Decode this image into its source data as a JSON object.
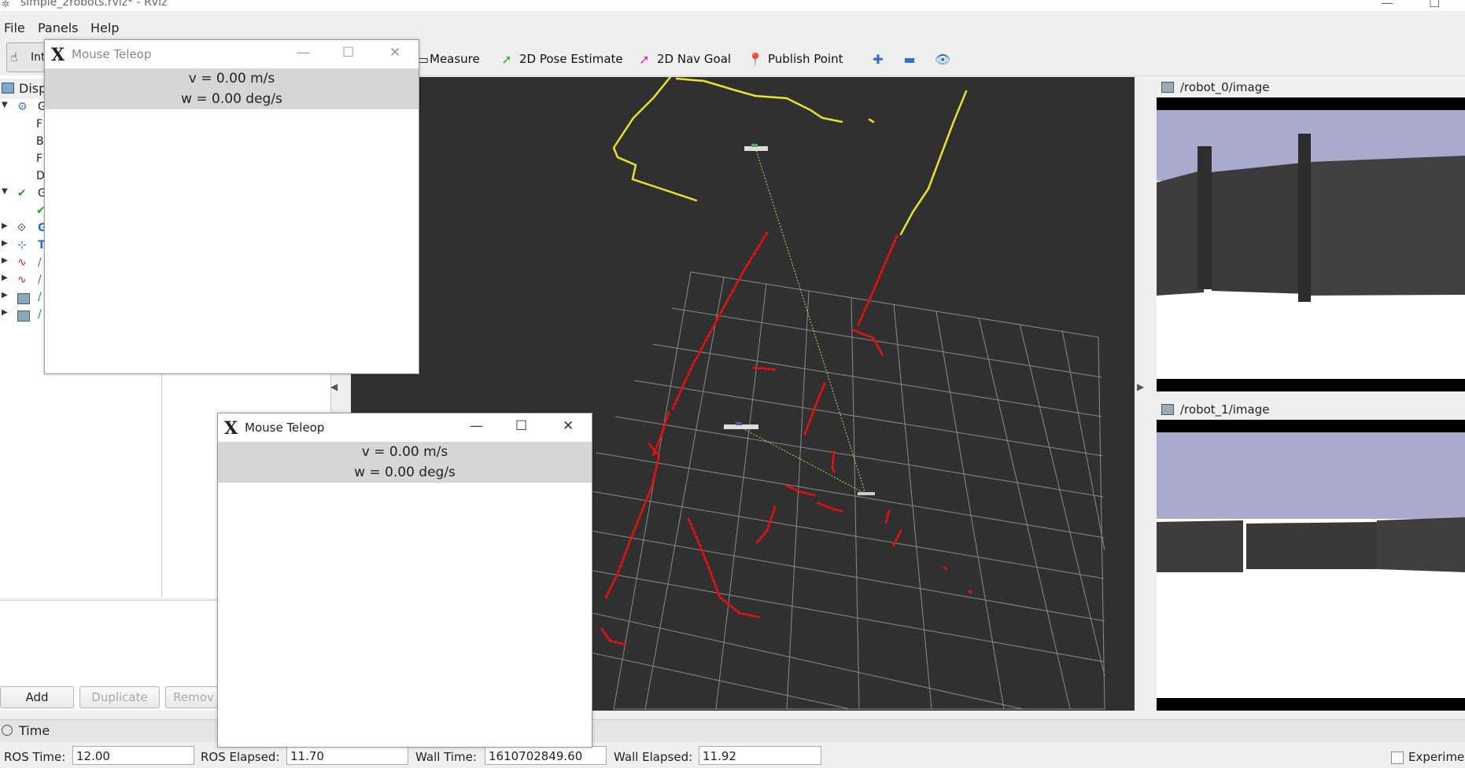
{
  "window": {
    "title": "simple_2robots.rviz* - RViz"
  },
  "menu": [
    "File",
    "Panels",
    "Help"
  ],
  "toolbar": {
    "interact": "Int",
    "measure": "Measure",
    "pose_estimate": "2D Pose Estimate",
    "nav_goal": "2D Nav Goal",
    "publish_point": "Publish Point"
  },
  "displays": {
    "header": "Disp",
    "rows": [
      "G",
      "F",
      "B",
      "F",
      "D",
      "G",
      "",
      "G",
      "T",
      "/",
      "/",
      "/",
      "/"
    ],
    "buttons": {
      "add": "Add",
      "duplicate": "Duplicate",
      "remove": "Remov"
    }
  },
  "image_panels": [
    {
      "title": "/robot_0/image"
    },
    {
      "title": "/robot_1/image"
    }
  ],
  "time": {
    "panel_title": "Time",
    "ros_time_label": "ROS Time:",
    "ros_time": "12.00",
    "ros_elapsed_label": "ROS Elapsed:",
    "ros_elapsed": "11.70",
    "wall_time_label": "Wall Time:",
    "wall_time": "1610702849.60",
    "wall_elapsed_label": "Wall Elapsed:",
    "wall_elapsed": "11.92",
    "experimental_label": "Experime"
  },
  "teleop": [
    {
      "title": "Mouse Teleop",
      "v": "v = 0.00 m/s",
      "w": "w = 0.00 deg/s"
    },
    {
      "title": "Mouse Teleop",
      "v": "v = 0.00 m/s",
      "w": "w = 0.00 deg/s"
    }
  ],
  "colors": {
    "viewport_bg": "#303030",
    "laser_0": "#e6e22e",
    "laser_1": "#e01010",
    "sky": "#aaaacc",
    "wall": "#3c3c3c"
  }
}
